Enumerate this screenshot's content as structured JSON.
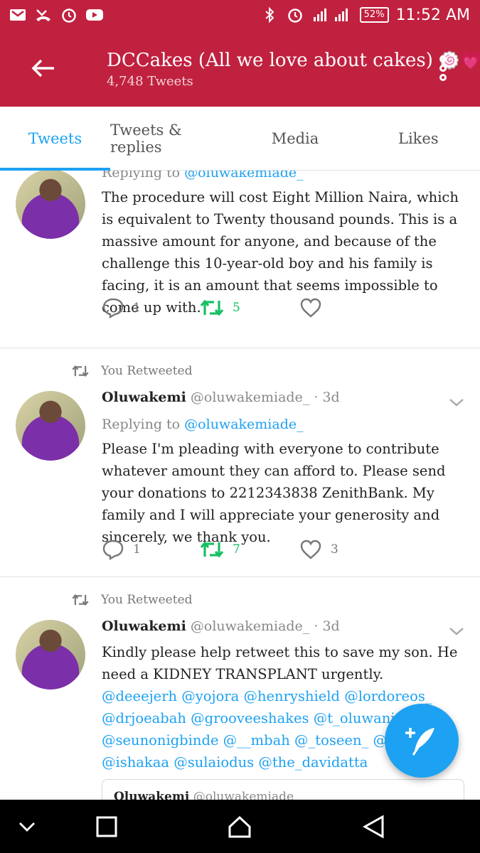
{
  "status_bar": {
    "battery": "52%",
    "time": "11:52 AM",
    "left_icons": [
      "gmail-icon",
      "missed-call-icon",
      "alarm-icon",
      "youtube-icon"
    ],
    "right_icons": [
      "bluetooth-icon",
      "alarm-icon",
      "signal-icon",
      "battery-icon"
    ]
  },
  "header": {
    "account_name": "DCCakes (All we love about cakes)",
    "account_emoji": "🍥💗",
    "tweet_count": "4,748 Tweets"
  },
  "tabs": [
    {
      "label": "Tweets",
      "active": true
    },
    {
      "label": "Tweets & replies",
      "active": false
    },
    {
      "label": "Media",
      "active": false
    },
    {
      "label": "Likes",
      "active": false
    }
  ],
  "tweets": [
    {
      "replying_prefix": "Replying to",
      "replying_handle": "@oluwakemiade_",
      "text": "The procedure will cost Eight Million Naira, which is equivalent to Twenty thousand pounds. This is a massive amount for anyone, and because of the challenge this 10-year-old boy and his family is facing, it is an amount that seems impossible to come up with.",
      "replies": "1",
      "retweets": "5",
      "likes": ""
    },
    {
      "retweet_label": "You Retweeted",
      "name": "Oluwakemi",
      "handle": "@oluwakemiade_",
      "time": "· 3d",
      "replying_prefix": "Replying to",
      "replying_handle": "@oluwakemiade_",
      "text": "Please I'm pleading with everyone to contribute whatever amount they can afford to. Please send your donations to 2212343838 ZenithBank. My family and I will appreciate your generosity and sincerely, we thank you.",
      "replies": "1",
      "retweets": "7",
      "likes": "3"
    },
    {
      "retweet_label": "You Retweeted",
      "name": "Oluwakemi",
      "handle": "@oluwakemiade_",
      "time": "· 3d",
      "text": "Kindly please help retweet this to save my son. He need a KIDNEY TRANSPLANT urgently.",
      "mentions": "@deeejerh @yojora @henryshield @lordoreos_ @drjoeabah @grooveeshakes @t_oluwani @bria... @seunonigbinde @__mbah @_toseen_ @teejay... @ishakaa @sulaiodus @the_davidatta",
      "quote_name": "Oluwakemi",
      "quote_handle": "@oluwakemiade_"
    }
  ],
  "colors": {
    "brand_bar": "#c0213f",
    "accent": "#1da1f2",
    "retweet_green": "#17bf63"
  }
}
